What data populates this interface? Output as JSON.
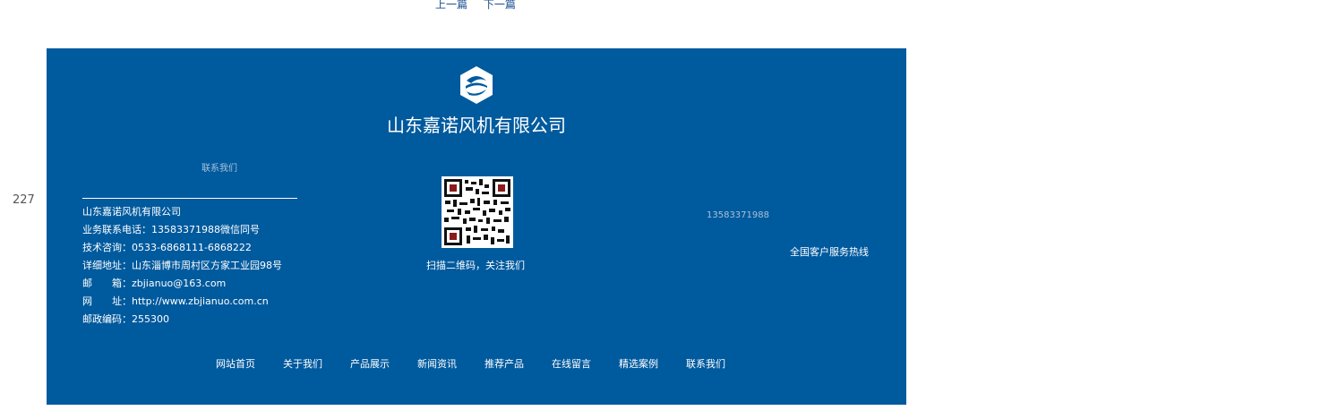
{
  "pager": {
    "prev": "上一篇",
    "next": "下一篇"
  },
  "side_number": "227",
  "footer": {
    "bg_color": "#005a9e",
    "company_name": "山东嘉诺风机有限公司",
    "contact_heading": "联系我们",
    "contact_lines": [
      "山东嘉诺风机有限公司",
      "业务联系电话：13583371988微信同号",
      "技术咨询：0533-6868111-6868222",
      "详细地址：山东淄博市周村区方家工业园98号",
      "邮　　箱：zbjianuo@163.com",
      "网　　址：http://www.zbjianuo.com.cn",
      "邮政编码：255300"
    ],
    "qr_caption": "扫描二维码，关注我们",
    "hotline_number": "13583371988",
    "hotline_label": "全国客户服务热线",
    "nav": [
      "网站首页",
      "关于我们",
      "产品展示",
      "新闻资讯",
      "推荐产品",
      "在线留言",
      "精选案例",
      "联系我们"
    ]
  }
}
